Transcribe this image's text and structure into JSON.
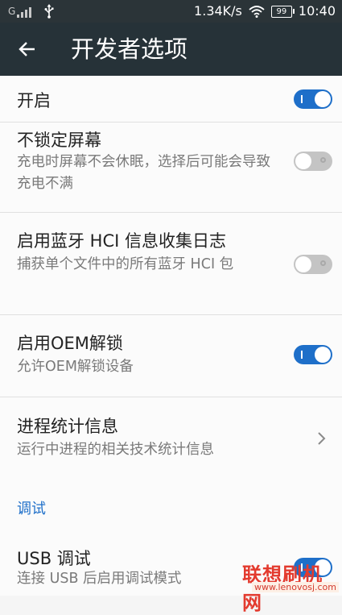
{
  "status_bar": {
    "carrier_label": "G",
    "network_speed": "1.34K/s",
    "battery_level": "99",
    "time": "10:40",
    "icons": [
      "signal-icon",
      "usb-icon",
      "wifi-icon",
      "battery-icon"
    ]
  },
  "app_bar": {
    "title": "开发者选项",
    "back_icon": "arrow-back-icon"
  },
  "settings": {
    "items": [
      {
        "title": "开启",
        "toggle": true
      },
      {
        "title": "不锁定屏幕",
        "summary": "充电时屏幕不会休眠，选择后可能会导致充电不满",
        "toggle": false
      },
      {
        "title": "启用蓝牙 HCI 信息收集日志",
        "summary": "捕获单个文件中的所有蓝牙 HCI 包",
        "toggle": false
      },
      {
        "title": "启用OEM解锁",
        "summary": "允许OEM解锁设备",
        "toggle": true
      },
      {
        "title": "进程统计信息",
        "summary": "运行中进程的相关技术统计信息",
        "chevron": true
      }
    ],
    "debug_section": {
      "header": "调试",
      "items": [
        {
          "title": "USB 调试",
          "summary": "连接 USB 后启用调试模式",
          "toggle": true
        }
      ]
    }
  },
  "watermark": {
    "main": "联想刷机网",
    "sub": "www.lenovosj.com"
  },
  "colors": {
    "status_bar_bg": "#2b3438",
    "app_bar_bg": "#263238",
    "accent": "#1e6fc9",
    "toggle_off": "#c4c4c4",
    "watermark": "#e33a2e"
  }
}
